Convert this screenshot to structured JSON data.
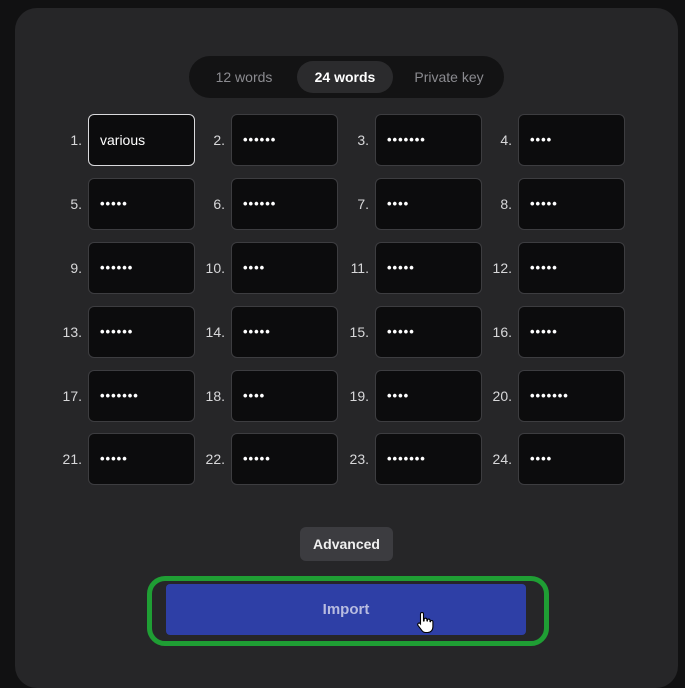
{
  "tabs": [
    {
      "label": "12 words",
      "active": false
    },
    {
      "label": "24 words",
      "active": true
    },
    {
      "label": "Private key",
      "active": false
    }
  ],
  "words": [
    {
      "num": "1.",
      "value": "various",
      "masked": false
    },
    {
      "num": "2.",
      "value": "••••••",
      "masked": true
    },
    {
      "num": "3.",
      "value": "•••••••",
      "masked": true
    },
    {
      "num": "4.",
      "value": "••••",
      "masked": true
    },
    {
      "num": "5.",
      "value": "•••••",
      "masked": true
    },
    {
      "num": "6.",
      "value": "••••••",
      "masked": true
    },
    {
      "num": "7.",
      "value": "••••",
      "masked": true
    },
    {
      "num": "8.",
      "value": "•••••",
      "masked": true
    },
    {
      "num": "9.",
      "value": "••••••",
      "masked": true
    },
    {
      "num": "10.",
      "value": "••••",
      "masked": true
    },
    {
      "num": "11.",
      "value": "•••••",
      "masked": true
    },
    {
      "num": "12.",
      "value": "•••••",
      "masked": true
    },
    {
      "num": "13.",
      "value": "••••••",
      "masked": true
    },
    {
      "num": "14.",
      "value": "•••••",
      "masked": true
    },
    {
      "num": "15.",
      "value": "•••••",
      "masked": true
    },
    {
      "num": "16.",
      "value": "•••••",
      "masked": true
    },
    {
      "num": "17.",
      "value": "•••••••",
      "masked": true
    },
    {
      "num": "18.",
      "value": "••••",
      "masked": true
    },
    {
      "num": "19.",
      "value": "••••",
      "masked": true
    },
    {
      "num": "20.",
      "value": "•••••••",
      "masked": true
    },
    {
      "num": "21.",
      "value": "•••••",
      "masked": true
    },
    {
      "num": "22.",
      "value": "•••••",
      "masked": true
    },
    {
      "num": "23.",
      "value": "•••••••",
      "masked": true
    },
    {
      "num": "24.",
      "value": "••••",
      "masked": true
    }
  ],
  "advanced_label": "Advanced",
  "import_label": "Import",
  "colors": {
    "accent": "#2e3fa6",
    "highlight": "#1f9e34"
  }
}
